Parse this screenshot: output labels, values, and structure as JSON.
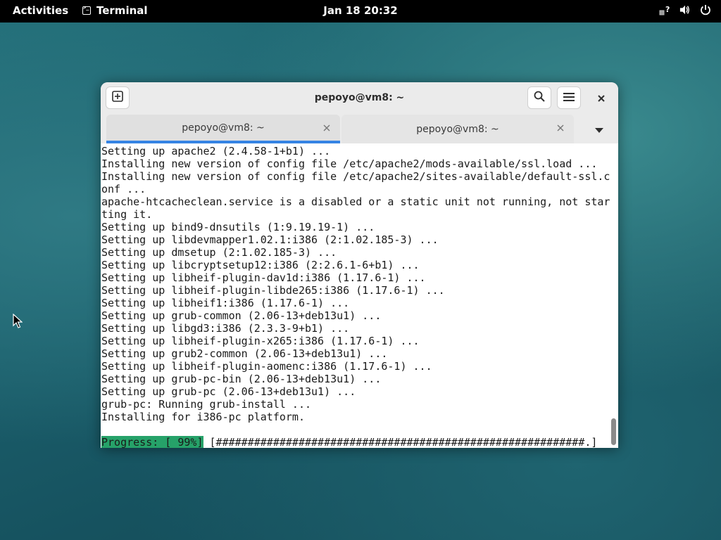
{
  "topbar": {
    "activities": "Activities",
    "app_name": "Terminal",
    "clock": "Jan 18  20:32"
  },
  "icons": {
    "tray": [
      "network-question-icon",
      "volume-icon",
      "power-icon"
    ],
    "app": "terminal-icon",
    "cursor": "mouse-pointer-icon"
  },
  "window": {
    "title": "pepoyo@vm8: ~",
    "tabs": [
      {
        "label": "pepoyo@vm8: ~",
        "active": true
      },
      {
        "label": "pepoyo@vm8: ~",
        "active": false
      }
    ]
  },
  "terminal": {
    "lines": [
      "Setting up apache2 (2.4.58-1+b1) ...",
      "Installing new version of config file /etc/apache2/mods-available/ssl.load ...",
      "Installing new version of config file /etc/apache2/sites-available/default-ssl.c",
      "onf ...",
      "apache-htcacheclean.service is a disabled or a static unit not running, not star",
      "ting it.",
      "Setting up bind9-dnsutils (1:9.19.19-1) ...",
      "Setting up libdevmapper1.02.1:i386 (2:1.02.185-3) ...",
      "Setting up dmsetup (2:1.02.185-3) ...",
      "Setting up libcryptsetup12:i386 (2:2.6.1-6+b1) ...",
      "Setting up libheif-plugin-dav1d:i386 (1.17.6-1) ...",
      "Setting up libheif-plugin-libde265:i386 (1.17.6-1) ...",
      "Setting up libheif1:i386 (1.17.6-1) ...",
      "Setting up grub-common (2.06-13+deb13u1) ...",
      "Setting up libgd3:i386 (2.3.3-9+b1) ...",
      "Setting up libheif-plugin-x265:i386 (1.17.6-1) ...",
      "Setting up grub2-common (2.06-13+deb13u1) ...",
      "Setting up libheif-plugin-aomenc:i386 (1.17.6-1) ...",
      "Setting up grub-pc-bin (2.06-13+deb13u1) ...",
      "Setting up grub-pc (2.06-13+deb13u1) ...",
      "grub-pc: Running grub-install ...",
      "Installing for i386-pc platform."
    ],
    "progress_label": "Progress: [ 99%]",
    "progress_bar": " [##########################################################.]",
    "progress_percent": 99,
    "progress_color": "#26a269"
  },
  "colors": {
    "accent": "#3584e4",
    "topbar": "#000000"
  }
}
